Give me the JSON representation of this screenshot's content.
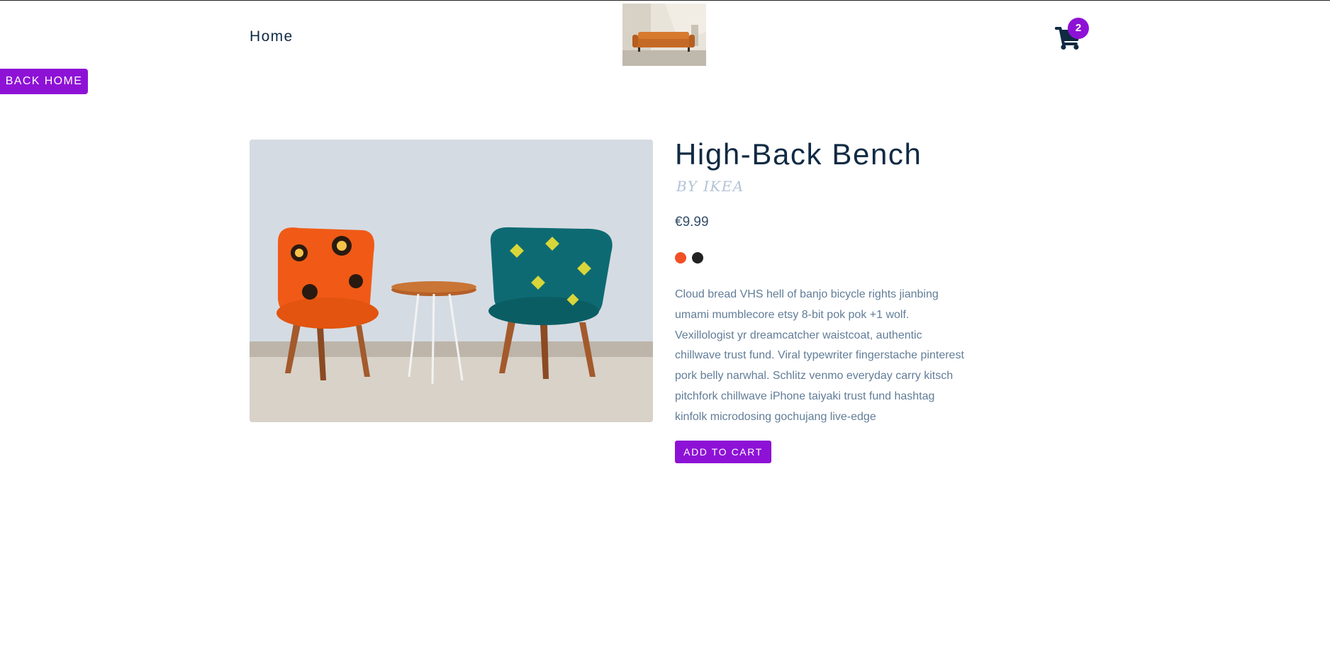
{
  "nav": {
    "home_label": "Home",
    "cart_count": "2"
  },
  "back_button_label": "back home",
  "product": {
    "title": "High-Back Bench",
    "company": "by ikea",
    "price": "€9.99",
    "colors": [
      "#f15025",
      "#222222"
    ],
    "description": "Cloud bread VHS hell of banjo bicycle rights jianbing umami mumblecore etsy 8-bit pok pok +1 wolf. Vexillologist yr dreamcatcher waistcoat, authentic chillwave trust fund. Viral typewriter fingerstache pinterest pork belly narwhal. Schlitz venmo everyday carry kitsch pitchfork chillwave iPhone taiyaki trust fund hashtag kinfolk microdosing gochujang live-edge",
    "add_button_label": "add to cart"
  },
  "icons": {
    "cart": "shopping-cart-icon"
  },
  "colors": {
    "accent": "#8e12d6",
    "heading": "#102a43",
    "muted": "#627d98",
    "company": "#b3c3d6"
  }
}
